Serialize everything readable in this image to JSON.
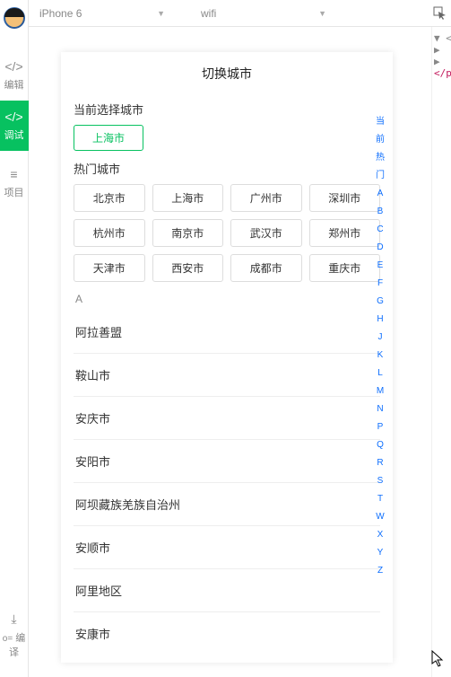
{
  "sidebar": {
    "items": [
      {
        "icon": "</>",
        "label": "编辑"
      },
      {
        "icon": "</>",
        "label": "调试"
      },
      {
        "icon": "≡",
        "label": "项目"
      }
    ],
    "bottom": {
      "icon": "⤓",
      "label": "编译"
    }
  },
  "topbar": {
    "device": "iPhone 6",
    "network": "wifi"
  },
  "code_panel": {
    "lines": [
      "▼ <",
      "  ▶",
      "  ▶",
      "</p"
    ]
  },
  "sim": {
    "title": "切换城市",
    "current_label": "当前选择城市",
    "current_city": "上海市",
    "hot_label": "热门城市",
    "hot_cities": [
      "北京市",
      "上海市",
      "广州市",
      "深圳市",
      "杭州市",
      "南京市",
      "武汉市",
      "郑州市",
      "天津市",
      "西安市",
      "成都市",
      "重庆市"
    ],
    "letter": "A",
    "a_cities": [
      "阿拉善盟",
      "鞍山市",
      "安庆市",
      "安阳市",
      "阿坝藏族羌族自治州",
      "安顺市",
      "阿里地区",
      "安康市"
    ],
    "alpha": [
      "当前",
      "热门",
      "A",
      "B",
      "C",
      "D",
      "E",
      "F",
      "G",
      "H",
      "J",
      "K",
      "L",
      "M",
      "N",
      "P",
      "Q",
      "R",
      "S",
      "T",
      "W",
      "X",
      "Y",
      "Z"
    ]
  }
}
